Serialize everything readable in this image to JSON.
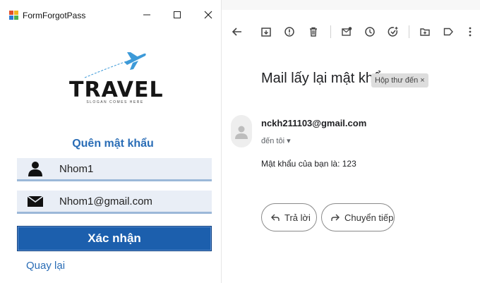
{
  "window": {
    "title": "FormForgotPass",
    "buttons": {
      "minimize": "minimize-icon",
      "maximize": "maximize-icon",
      "close": "close-icon"
    }
  },
  "logo": {
    "text": "TRAVEL",
    "slogan": "SLOGAN COMES HERE"
  },
  "form": {
    "heading": "Quên mật khẩu",
    "username_value": "Nhom1",
    "email_value": "Nhom1@gmail.com",
    "confirm_label": "Xác nhận",
    "back_label": "Quay lại"
  },
  "gmail": {
    "toolbar_icons": [
      "back-arrow-icon",
      "archive-icon",
      "report-spam-icon",
      "delete-icon",
      "mark-unread-icon",
      "snooze-icon",
      "add-task-icon",
      "move-to-icon",
      "label-icon",
      "more-icon"
    ],
    "subject": "Mail lấy lại mật khẩu",
    "label_chip": "Hộp thư đến ×",
    "sender": "nckh211103@gmail.com",
    "to_line": "đến tôi ▾",
    "body": "Mật khẩu của bạn là: 123",
    "reply_label": "Trả lời",
    "forward_label": "Chuyển tiếp"
  },
  "colors": {
    "accent_blue": "#2a6db6",
    "button_blue": "#1c5fad",
    "field_bg": "#e9eef6",
    "plane_blue": "#3d9ad8"
  }
}
